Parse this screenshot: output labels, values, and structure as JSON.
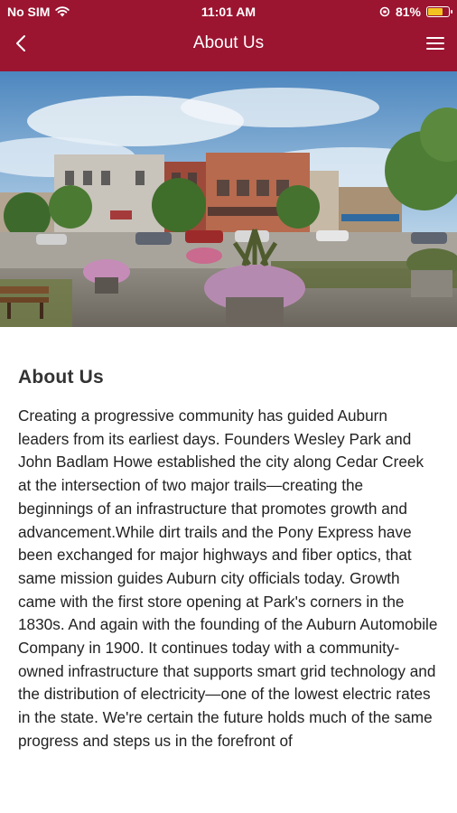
{
  "status_bar": {
    "carrier": "No SIM",
    "time": "11:01 AM",
    "battery": "81%",
    "battery_level": 0.81
  },
  "nav": {
    "title": "About Us",
    "back_icon": "chevron-left-icon",
    "menu_icon": "hamburger-menu-icon"
  },
  "hero": {
    "image": "downtown-street-photo"
  },
  "content": {
    "heading": "About Us",
    "paragraph": "Creating a progressive community has guided Auburn leaders from its earliest days. Founders Wesley Park and John Badlam Howe established the city along Cedar Creek at the intersection of two major trails—creating the beginnings of an infrastructure that promotes growth and advancement.While dirt trails and the Pony Express have been exchanged for major highways and fiber optics, that same mission guides Auburn city officials today. Growth came with the first store opening at Park's corners in the 1830s. And again with the founding of the Auburn Automobile Company in 1900. It continues today with a community-owned infrastructure that supports smart grid technology and the distribution of electricity—one of the lowest electric rates in the state. We're certain the future holds much of the same progress and steps us in the forefront of"
  },
  "colors": {
    "header": "#9b1430",
    "battery": "#f3c221"
  }
}
